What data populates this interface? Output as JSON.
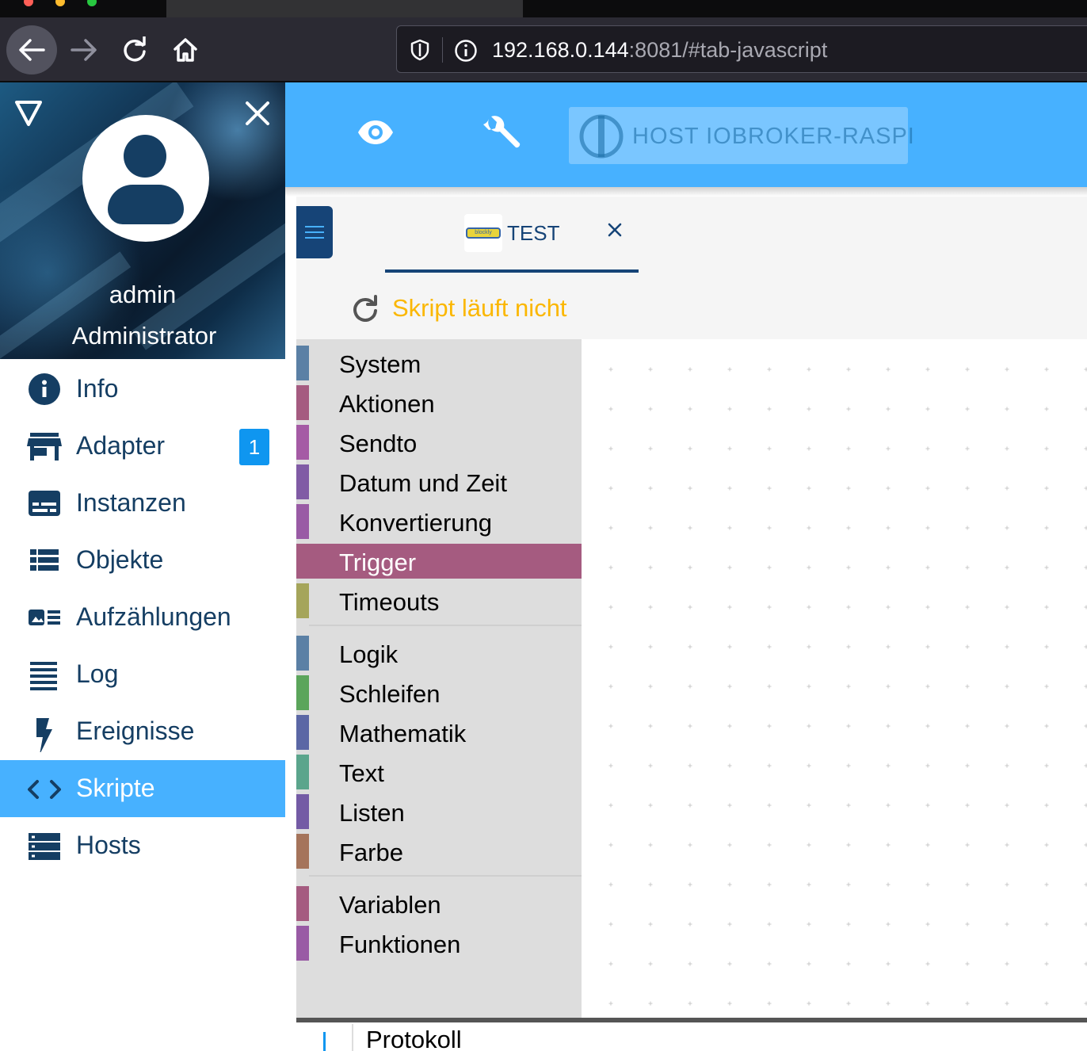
{
  "browser": {
    "url_host": "192.168.0.144",
    "url_rest": ":8081/#tab-javascript"
  },
  "sidebar": {
    "user_name": "admin",
    "user_role": "Administrator",
    "items": [
      {
        "label": "Info",
        "icon": "info-icon"
      },
      {
        "label": "Adapter",
        "icon": "store-icon",
        "badge": "1"
      },
      {
        "label": "Instanzen",
        "icon": "subtitles-icon"
      },
      {
        "label": "Objekte",
        "icon": "list-icon"
      },
      {
        "label": "Aufzählungen",
        "icon": "featured-list-icon"
      },
      {
        "label": "Log",
        "icon": "lines-icon"
      },
      {
        "label": "Ereignisse",
        "icon": "lightning-icon"
      },
      {
        "label": "Skripte",
        "icon": "code-icon",
        "active": true
      },
      {
        "label": "Hosts",
        "icon": "dns-icon"
      }
    ]
  },
  "appbar": {
    "host_label": "HOST IOBROKER-RASPI"
  },
  "script_tab": {
    "logo_text": "blockly",
    "name": "TEST"
  },
  "status": {
    "text": "Skript läuft nicht",
    "color": "#fbb700"
  },
  "toolbox": {
    "groups": [
      [
        {
          "label": "System",
          "color": "#5b80a5"
        },
        {
          "label": "Aktionen",
          "color": "#a55b80"
        },
        {
          "label": "Sendto",
          "color": "#a55ba5"
        },
        {
          "label": "Datum und Zeit",
          "color": "#805ba5"
        },
        {
          "label": "Konvertierung",
          "color": "#995ba5"
        },
        {
          "label": "Trigger",
          "color": "#a55b80",
          "selected": true
        },
        {
          "label": "Timeouts",
          "color": "#a5a55b"
        }
      ],
      [
        {
          "label": "Logik",
          "color": "#5b80a5"
        },
        {
          "label": "Schleifen",
          "color": "#5ba55b"
        },
        {
          "label": "Mathematik",
          "color": "#5b67a5"
        },
        {
          "label": "Text",
          "color": "#5ba58c"
        },
        {
          "label": "Listen",
          "color": "#745ba5"
        },
        {
          "label": "Farbe",
          "color": "#a5745b"
        }
      ],
      [
        {
          "label": "Variablen",
          "color": "#a55b80"
        },
        {
          "label": "Funktionen",
          "color": "#995ba5"
        }
      ]
    ]
  },
  "log_panel": {
    "label": "Protokoll"
  },
  "colors": {
    "accent": "#47b1ff",
    "primary_dark": "#164477",
    "badge": "#0f96f0"
  }
}
